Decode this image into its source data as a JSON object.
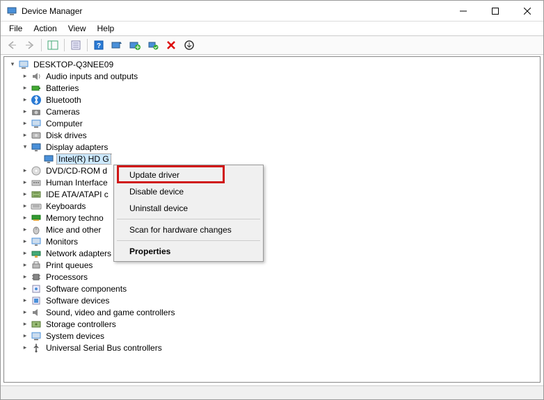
{
  "window": {
    "title": "Device Manager"
  },
  "menu": {
    "file": "File",
    "action": "Action",
    "view": "View",
    "help": "Help"
  },
  "tree": {
    "root": "DESKTOP-Q3NEE09",
    "audio": "Audio inputs and outputs",
    "batteries": "Batteries",
    "bluetooth": "Bluetooth",
    "cameras": "Cameras",
    "computer": "Computer",
    "disk": "Disk drives",
    "display": "Display adapters",
    "display_child": "Intel(R) HD G",
    "dvd": "DVD/CD-ROM d",
    "hid": "Human Interface",
    "ide": "IDE ATA/ATAPI c",
    "keyboards": "Keyboards",
    "memory": "Memory techno",
    "mice": "Mice and other",
    "monitors": "Monitors",
    "network": "Network adapters",
    "print": "Print queues",
    "processors": "Processors",
    "swcomp": "Software components",
    "swdev": "Software devices",
    "sound": "Sound, video and game controllers",
    "storage": "Storage controllers",
    "system": "System devices",
    "usb": "Universal Serial Bus controllers"
  },
  "context": {
    "update": "Update driver",
    "disable": "Disable device",
    "uninstall": "Uninstall device",
    "scan": "Scan for hardware changes",
    "properties": "Properties"
  }
}
